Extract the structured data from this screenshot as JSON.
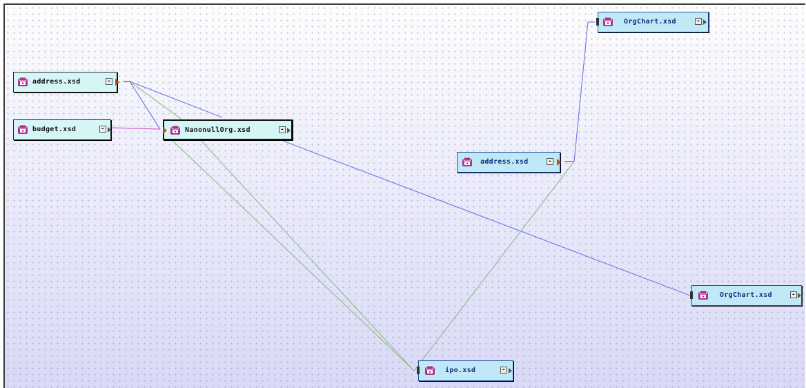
{
  "nodes": [
    {
      "id": "address1",
      "label": "address.xsd"
    },
    {
      "id": "budget",
      "label": "budget.xsd"
    },
    {
      "id": "nanonull",
      "label": "NanonullOrg.xsd"
    },
    {
      "id": "orgchart1",
      "label": "OrgChart.xsd"
    },
    {
      "id": "address2",
      "label": "address.xsd"
    },
    {
      "id": "orgchart2",
      "label": "OrgChart.xsd"
    },
    {
      "id": "ipo",
      "label": "ipo.xsd"
    }
  ],
  "expand_symbol": "-",
  "colors": {
    "link_blue": "#7a7ae6",
    "link_green": "#8fc08f",
    "link_magenta": "#d060d0",
    "link_orange": "#d06010",
    "icon_purple": "#b0308f"
  },
  "icon": "database-schema-icon"
}
